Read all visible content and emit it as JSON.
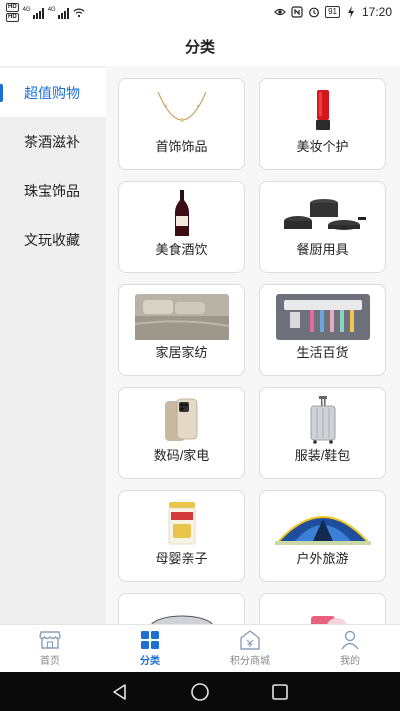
{
  "status_bar": {
    "hd_label": "HD",
    "net_label": "4G",
    "battery_level": "91",
    "time": "17:20",
    "icons": [
      "eye-icon",
      "nfc-icon",
      "alarm-icon",
      "charging-icon"
    ]
  },
  "header": {
    "title": "分类"
  },
  "sidebar": {
    "items": [
      {
        "label": "超值购物",
        "active": true
      },
      {
        "label": "茶酒滋补",
        "active": false
      },
      {
        "label": "珠宝饰品",
        "active": false
      },
      {
        "label": "文玩收藏",
        "active": false
      }
    ]
  },
  "categories": [
    {
      "label": "首饰饰品",
      "icon": "necklace-icon"
    },
    {
      "label": "美妆个护",
      "icon": "lipstick-icon"
    },
    {
      "label": "美食酒饮",
      "icon": "wine-bottle-icon"
    },
    {
      "label": "餐厨用具",
      "icon": "cookware-icon"
    },
    {
      "label": "家居家纺",
      "icon": "bedding-icon"
    },
    {
      "label": "生活百货",
      "icon": "toothbrush-holder-icon"
    },
    {
      "label": "数码/家电",
      "icon": "phone-icon"
    },
    {
      "label": "服装/鞋包",
      "icon": "suitcase-icon"
    },
    {
      "label": "母婴亲子",
      "icon": "formula-can-icon"
    },
    {
      "label": "户外旅游",
      "icon": "tent-icon"
    }
  ],
  "bottom_nav": {
    "items": [
      {
        "label": "首页",
        "icon": "store-icon",
        "active": false
      },
      {
        "label": "分类",
        "icon": "grid-icon",
        "active": true
      },
      {
        "label": "积分商城",
        "icon": "points-mall-icon",
        "active": false
      },
      {
        "label": "我的",
        "icon": "user-icon",
        "active": false
      }
    ]
  },
  "colors": {
    "accent": "#1d6fd6",
    "sidebar_bg": "#efefef",
    "inactive_nav": "#888888"
  }
}
